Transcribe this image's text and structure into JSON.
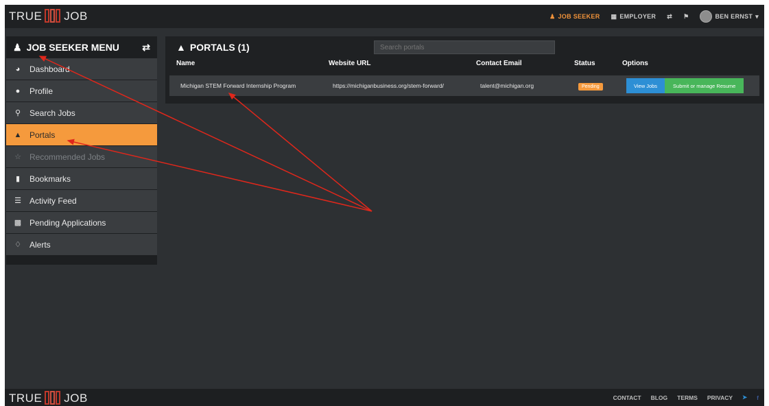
{
  "header": {
    "brand_left": "TRUE",
    "brand_right": "JOB",
    "nav": {
      "job_seeker": "JOB SEEKER",
      "employer": "EMPLOYER",
      "user_name": "BEN ERNST"
    }
  },
  "sidebar": {
    "title": "JOB SEEKER MENU",
    "items": [
      {
        "label": "Dashboard",
        "icon": "dashboard-icon"
      },
      {
        "label": "Profile",
        "icon": "profile-icon"
      },
      {
        "label": "Search Jobs",
        "icon": "search-icon"
      },
      {
        "label": "Portals",
        "icon": "portals-icon"
      },
      {
        "label": "Recommended Jobs",
        "icon": "star-icon"
      },
      {
        "label": "Bookmarks",
        "icon": "bookmark-icon"
      },
      {
        "label": "Activity Feed",
        "icon": "feed-icon"
      },
      {
        "label": "Pending Applications",
        "icon": "briefcase-icon"
      },
      {
        "label": "Alerts",
        "icon": "bell-icon"
      }
    ]
  },
  "portals": {
    "title": "PORTALS (1)",
    "search_placeholder": "Search portals",
    "columns": [
      "Name",
      "Website URL",
      "Contact Email",
      "Status",
      "Options"
    ],
    "rows": [
      {
        "name": "Michigan STEM Forward Internship Program",
        "url": "https://michiganbusiness.org/stem-forward/",
        "email": "talent@michigan.org",
        "status": "Pending",
        "view_jobs": "View Jobs",
        "submit_resume": "Submit or manage Resume"
      }
    ]
  },
  "footer": {
    "brand_left": "TRUE",
    "brand_right": "JOB",
    "links": [
      "CONTACT",
      "BLOG",
      "TERMS",
      "PRIVACY"
    ]
  },
  "colors": {
    "accent": "#f59a3d",
    "annotation": "#e0271b",
    "blue_button": "#2d8fd5",
    "green_button": "#48b65a"
  }
}
